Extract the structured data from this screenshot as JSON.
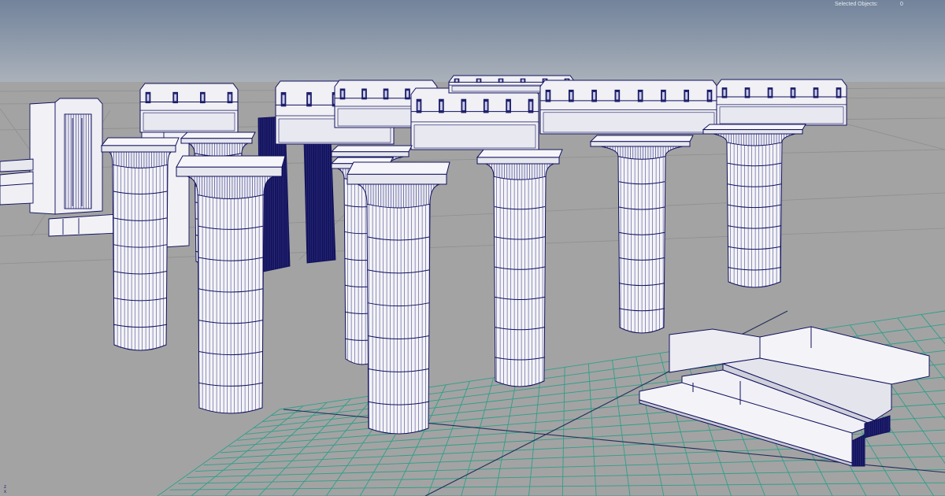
{
  "hud": {
    "selected_objects_label": "Selected Objects:",
    "selected_objects_count": "0"
  },
  "colors": {
    "sky_top": "#7a8aa0",
    "sky_bottom": "#a9b0b9",
    "ground": "#a3a3a3",
    "grid": "#2e9f8a",
    "wire": "#10105e",
    "face": "#f4f4f8"
  }
}
